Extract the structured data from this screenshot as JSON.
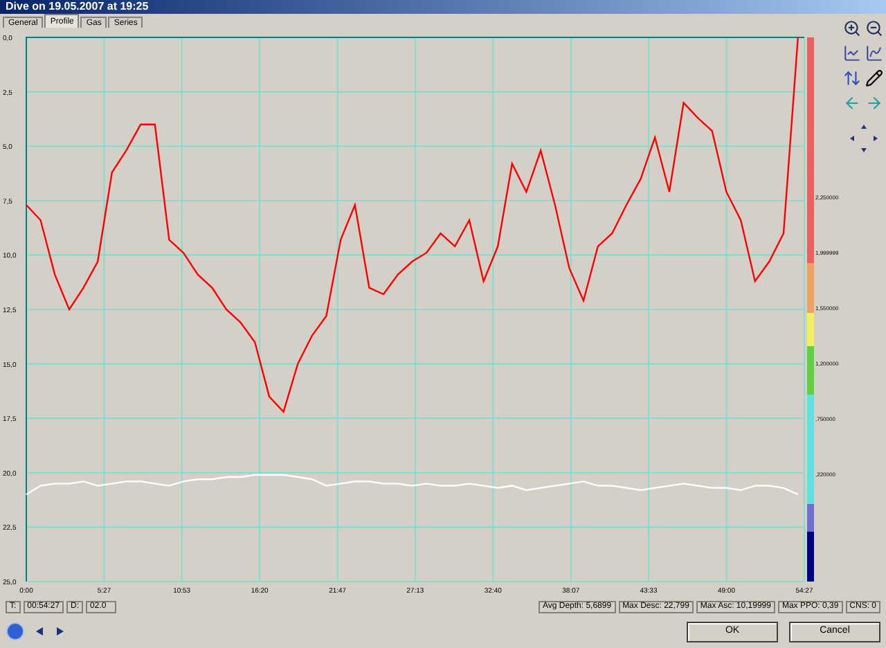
{
  "window": {
    "title": "Dive on 19.05.2007 at 19:25"
  },
  "tabs": [
    {
      "label": "General",
      "selected": false
    },
    {
      "label": "Profile",
      "selected": true
    },
    {
      "label": "Gas",
      "selected": false
    },
    {
      "label": "Series",
      "selected": false
    }
  ],
  "chart": {
    "chart_data": {
      "type": "line",
      "xlim": [
        0,
        54.45
      ],
      "ylim": [
        25,
        0
      ],
      "grid": true,
      "xticks": [
        {
          "value": 0,
          "label": "0:00"
        },
        {
          "value": 5.45,
          "label": "5:27"
        },
        {
          "value": 10.883,
          "label": "10:53"
        },
        {
          "value": 16.333,
          "label": "16:20"
        },
        {
          "value": 21.783,
          "label": "21:47"
        },
        {
          "value": 27.217,
          "label": "27:13"
        },
        {
          "value": 32.667,
          "label": "32:40"
        },
        {
          "value": 38.117,
          "label": "38:07"
        },
        {
          "value": 43.55,
          "label": "43:33"
        },
        {
          "value": 49,
          "label": "49:00"
        },
        {
          "value": 54.45,
          "label": "54:27"
        }
      ],
      "yticks": [
        {
          "value": 0,
          "label": "0,0"
        },
        {
          "value": 2.5,
          "label": "2,5"
        },
        {
          "value": 5,
          "label": "5,0"
        },
        {
          "value": 7.5,
          "label": "7,5"
        },
        {
          "value": 10,
          "label": "10,0"
        },
        {
          "value": 12.5,
          "label": "12,5"
        },
        {
          "value": 15,
          "label": "15,0"
        },
        {
          "value": 17.5,
          "label": "17,5"
        },
        {
          "value": 20,
          "label": "20,0"
        },
        {
          "value": 22.5,
          "label": "22,5"
        },
        {
          "value": 25,
          "label": "25,0"
        }
      ],
      "x": [
        0,
        1,
        2,
        3,
        4,
        5,
        6,
        7,
        8,
        9,
        10,
        11,
        12,
        13,
        14,
        15,
        16,
        17,
        18,
        19,
        20,
        21,
        22,
        23,
        24,
        25,
        26,
        27,
        28,
        29,
        30,
        31,
        32,
        33,
        34,
        35,
        36,
        37,
        38,
        39,
        40,
        41,
        42,
        43,
        44,
        45,
        46,
        47,
        48,
        49,
        50,
        51,
        52,
        53,
        54
      ],
      "series": [
        {
          "color": "#ff0000",
          "values": [
            7.7,
            8.4,
            10.9,
            12.5,
            11.5,
            10.3,
            6.2,
            5.2,
            4.0,
            4.0,
            9.3,
            9.9,
            10.9,
            11.5,
            12.5,
            13.1,
            14.0,
            16.5,
            17.2,
            15.0,
            13.7,
            12.8,
            9.3,
            7.7,
            11.5,
            11.8,
            10.9,
            10.3,
            9.9,
            9.0,
            9.6,
            8.4,
            11.2,
            9.6,
            5.8,
            7.1,
            5.2,
            7.7,
            10.6,
            12.1,
            9.6,
            9.0,
            7.7,
            6.5,
            4.6,
            7.1,
            3.0,
            3.7,
            4.3,
            7.1,
            8.4,
            11.2,
            10.3,
            9.0,
            0.0
          ]
        },
        {
          "color": "#ffffff",
          "values": [
            21.0,
            20.6,
            20.5,
            20.5,
            20.4,
            20.6,
            20.5,
            20.4,
            20.4,
            20.5,
            20.6,
            20.4,
            20.3,
            20.3,
            20.2,
            20.2,
            20.1,
            20.1,
            20.1,
            20.2,
            20.3,
            20.6,
            20.5,
            20.4,
            20.4,
            20.5,
            20.5,
            20.6,
            20.5,
            20.6,
            20.6,
            20.5,
            20.6,
            20.7,
            20.6,
            20.8,
            20.7,
            20.6,
            20.5,
            20.4,
            20.6,
            20.6,
            20.7,
            20.8,
            20.7,
            20.6,
            20.5,
            20.6,
            20.7,
            20.7,
            20.8,
            20.6,
            20.6,
            20.7,
            21.0
          ]
        }
      ]
    },
    "color_scale": {
      "labels": [
        "2,250000",
        "1,999999",
        "1,550000",
        "1,200000",
        ",750000",
        ",220000"
      ]
    }
  },
  "status": {
    "time_label": "T:",
    "time": "00:54:27",
    "depth_label": "D:",
    "depth": "02.0",
    "stats": [
      "Avg Depth: 5,6899",
      "Max Desc: 22,799",
      "Max Asc: 10,19999",
      "Max PPO: 0,39",
      "CNS: 0"
    ]
  },
  "buttons": [
    "OK",
    "Cancel"
  ]
}
